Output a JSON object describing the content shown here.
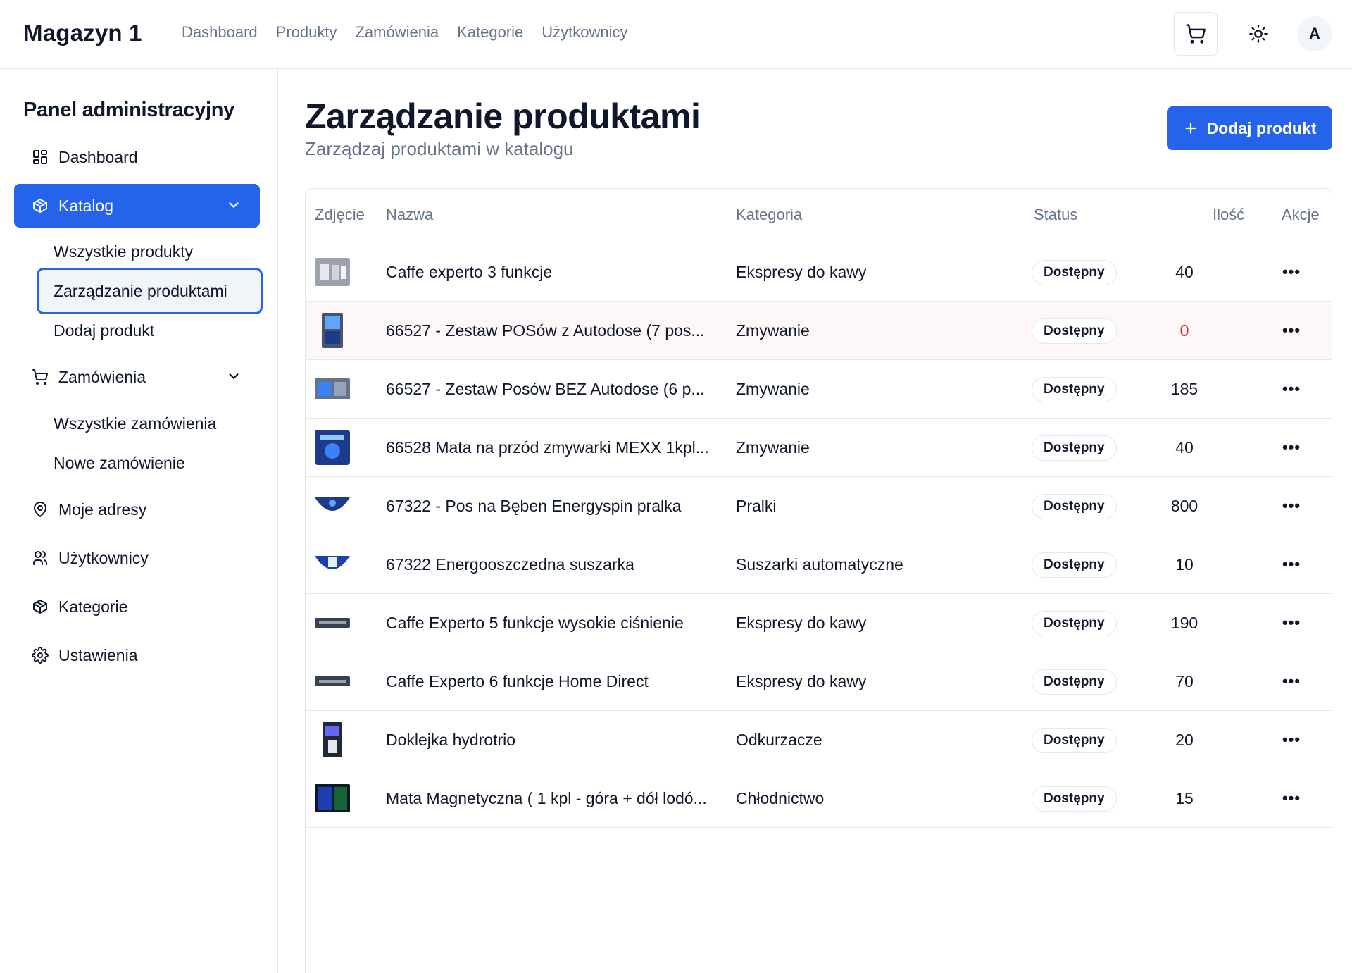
{
  "app": {
    "brand": "Magazyn 1"
  },
  "topnav": [
    "Dashboard",
    "Produkty",
    "Zamówienia",
    "Kategorie",
    "Użytkownicy"
  ],
  "user": {
    "avatar_initial": "A"
  },
  "sidebar": {
    "title": "Panel administracyjny",
    "dashboard": "Dashboard",
    "katalog": "Katalog",
    "katalog_sub": [
      "Wszystkie produkty",
      "Zarządzanie produktami",
      "Dodaj produkt"
    ],
    "zamowienia": "Zamówienia",
    "zamowienia_sub": [
      "Wszystkie zamówienia",
      "Nowe zamówienie"
    ],
    "adresy": "Moje adresy",
    "uzytkownicy": "Użytkownicy",
    "kategorie": "Kategorie",
    "ustawienia": "Ustawienia"
  },
  "page": {
    "title": "Zarządzanie produktami",
    "subtitle": "Zarządzaj produktami w katalogu",
    "add_button": "Dodaj produkt"
  },
  "table": {
    "headers": {
      "photo": "Zdjęcie",
      "name": "Nazwa",
      "category": "Kategoria",
      "status": "Status",
      "qty": "Ilość",
      "actions": "Akcje"
    },
    "rows": [
      {
        "name": "Caffe experto 3 funkcje",
        "category": "Ekspresy do kawy",
        "status": "Dostępny",
        "qty": "40",
        "thumb": "gray-wide"
      },
      {
        "name": "66527 - Zestaw POSów z Autodose (7 pos...",
        "category": "Zmywanie",
        "status": "Dostępny",
        "qty": "0",
        "thumb": "tall-blue"
      },
      {
        "name": "66527 - Zestaw Posów BEZ Autodose (6 p...",
        "category": "Zmywanie",
        "status": "Dostępny",
        "qty": "185",
        "thumb": "wide-blue"
      },
      {
        "name": "66528 Mata na przód zmywarki MEXX 1kpl...",
        "category": "Zmywanie",
        "status": "Dostępny",
        "qty": "40",
        "thumb": "square-blue"
      },
      {
        "name": "67322 - Pos na Bęben Energyspin pralka",
        "category": "Pralki",
        "status": "Dostępny",
        "qty": "800",
        "thumb": "arc-blue"
      },
      {
        "name": "67322 Energooszczedna suszarka",
        "category": "Suszarki automatyczne",
        "status": "Dostępny",
        "qty": "10",
        "thumb": "arc-light"
      },
      {
        "name": "Caffe Experto 5 funkcje wysokie ciśnienie",
        "category": "Ekspresy do kawy",
        "status": "Dostępny",
        "qty": "190",
        "thumb": "strip-dark"
      },
      {
        "name": "Caffe Experto 6 funkcje Home Direct",
        "category": "Ekspresy do kawy",
        "status": "Dostępny",
        "qty": "70",
        "thumb": "strip-dark"
      },
      {
        "name": "Doklejka hydrotrio",
        "category": "Odkurzacze",
        "status": "Dostępny",
        "qty": "20",
        "thumb": "tall-dark"
      },
      {
        "name": "Mata Magnetyczna ( 1 kpl - góra + dół lodó...",
        "category": "Chłodnictwo",
        "status": "Dostępny",
        "qty": "15",
        "thumb": "square-dark"
      }
    ],
    "actions_glyph": "•••"
  },
  "colors": {
    "primary": "#2563eb",
    "danger": "#dc2626",
    "muted": "#64748b"
  }
}
